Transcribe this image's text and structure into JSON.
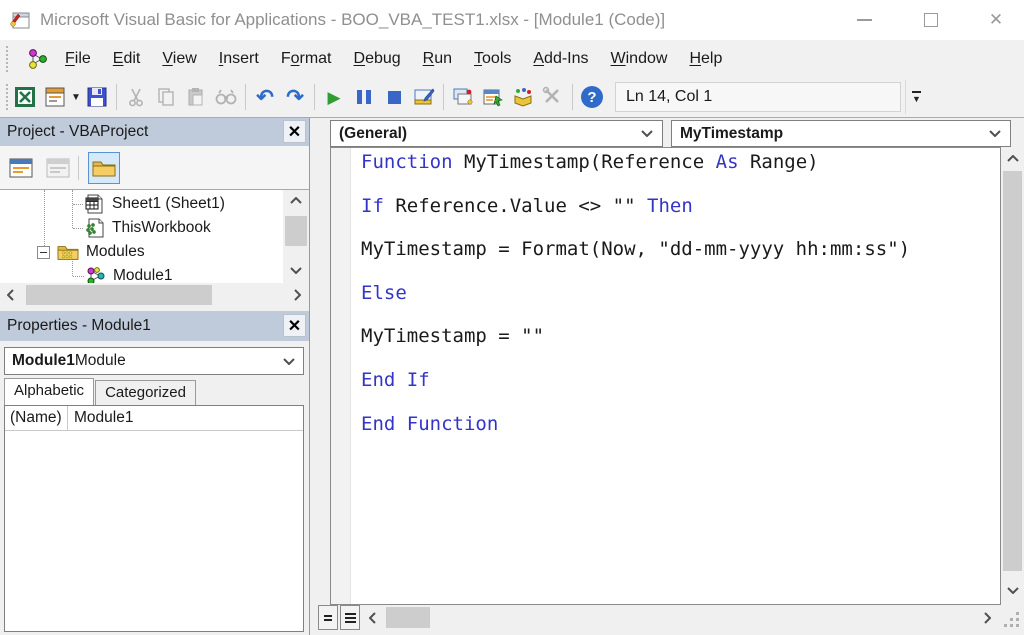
{
  "colors": {
    "keyword": "#3434c8",
    "panel_header_bg": "#bfcbdb",
    "toolbar_bg": "#f1f1f1",
    "scroll_thumb": "#cdcdcd",
    "scroll_track": "#f0f0f0",
    "selection_bg": "#d6e9fb",
    "selection_border": "#5a93d1"
  },
  "titlebar": {
    "title": "Microsoft Visual Basic for Applications - BOO_VBA_TEST1.xlsx - [Module1 (Code)]",
    "close_glyph": "✕"
  },
  "menubar": {
    "items": [
      {
        "label": "File",
        "underline": 0
      },
      {
        "label": "Edit",
        "underline": 0
      },
      {
        "label": "View",
        "underline": 0
      },
      {
        "label": "Insert",
        "underline": 0
      },
      {
        "label": "Format",
        "underline": 1
      },
      {
        "label": "Debug",
        "underline": 0
      },
      {
        "label": "Run",
        "underline": 0
      },
      {
        "label": "Tools",
        "underline": 0
      },
      {
        "label": "Add-Ins",
        "underline": 0
      },
      {
        "label": "Window",
        "underline": 0
      },
      {
        "label": "Help",
        "underline": 0
      }
    ],
    "mdi_minimize_glyph": "_",
    "mdi_close_glyph": "✕"
  },
  "toolbar": {
    "status": "Ln 14, Col 1",
    "undo_glyph": "↶",
    "redo_glyph": "↷",
    "run_glyph": "▶",
    "help_glyph": "?",
    "overflow_glyph": "▼",
    "insert_caret_glyph": "▼",
    "icon_names": [
      "view-excel-icon",
      "insert-userform-icon",
      "save-icon",
      "cut-icon",
      "copy-icon",
      "paste-icon",
      "find-icon",
      "undo-icon",
      "redo-icon",
      "run-icon",
      "break-icon",
      "reset-icon",
      "design-mode-icon",
      "project-explorer-icon",
      "properties-window-icon",
      "object-browser-icon",
      "toolbox-icon",
      "help-icon"
    ]
  },
  "project_panel": {
    "title": "Project - VBAProject",
    "close_glyph": "✕",
    "expander_glyph": "−",
    "overflow_glyph": "▼",
    "tree": [
      {
        "label": "Sheet1 (Sheet1)",
        "icon": "worksheet-icon"
      },
      {
        "label": "ThisWorkbook",
        "icon": "workbook-icon"
      },
      {
        "label": "Modules",
        "icon": "folder-icon"
      },
      {
        "label": "Module1",
        "icon": "module-icon",
        "selected": true
      }
    ]
  },
  "properties_panel": {
    "title": "Properties - Module1",
    "close_glyph": "✕",
    "object_name": "Module1",
    "object_type": " Module",
    "tabs": [
      {
        "label": "Alphabetic",
        "active": true
      },
      {
        "label": "Categorized",
        "active": false
      }
    ],
    "rows": [
      {
        "key": "(Name)",
        "value": "Module1"
      }
    ]
  },
  "code_window": {
    "object_dropdown": "(General)",
    "procedure_dropdown": "MyTimestamp",
    "lines": [
      [
        [
          "k",
          "Function"
        ],
        [
          "p",
          " MyTimestamp(Reference "
        ],
        [
          "k",
          "As"
        ],
        [
          "p",
          " Range)"
        ]
      ],
      [],
      [
        [
          "k",
          "If"
        ],
        [
          "p",
          " Reference.Value <> \"\" "
        ],
        [
          "k",
          "Then"
        ]
      ],
      [],
      [
        [
          "p",
          "MyTimestamp = Format(Now, \"dd-mm-yyyy hh:mm:ss\")"
        ]
      ],
      [],
      [
        [
          "k",
          "Else"
        ]
      ],
      [],
      [
        [
          "p",
          "MyTimestamp = \"\""
        ]
      ],
      [],
      [
        [
          "k",
          "End If"
        ]
      ],
      [],
      [
        [
          "k",
          "End Function"
        ]
      ]
    ]
  }
}
